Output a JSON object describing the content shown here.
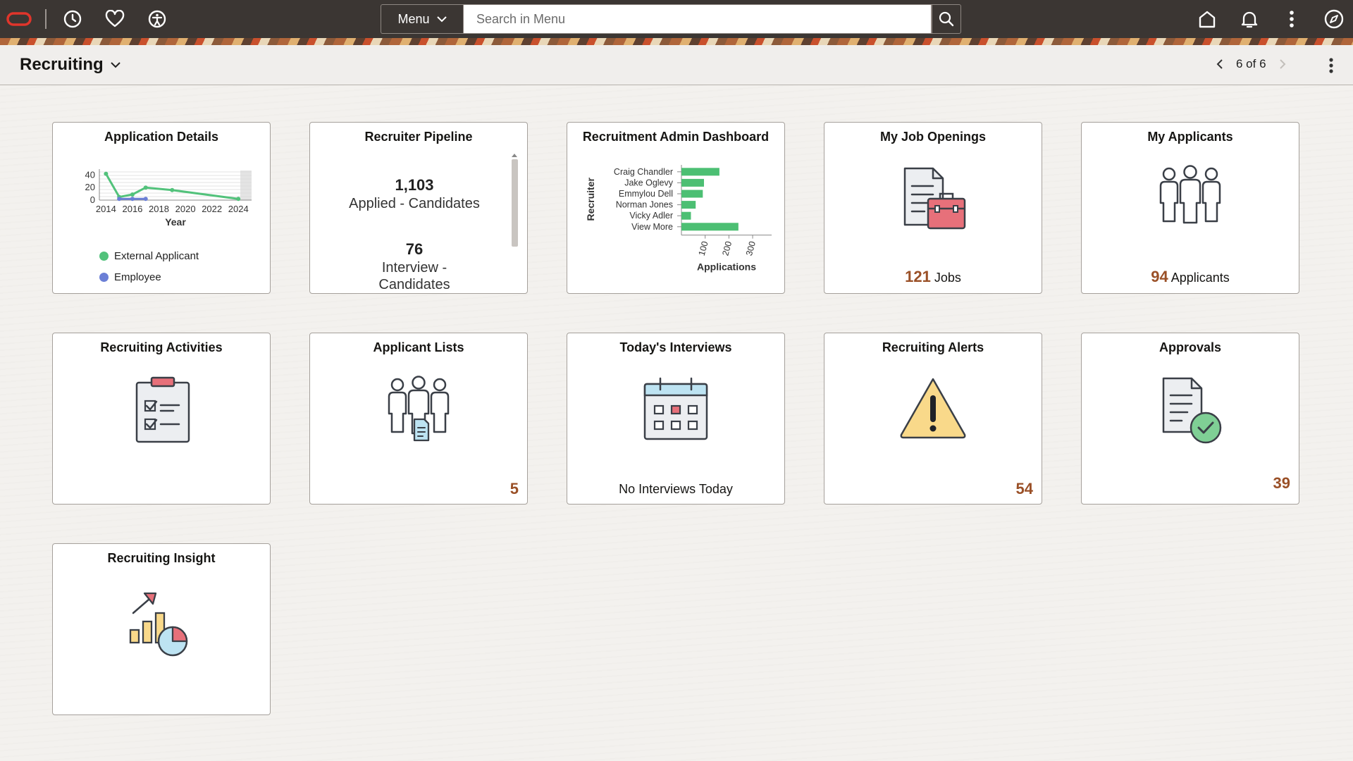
{
  "search": {
    "menu_label": "Menu",
    "placeholder": "Search in Menu"
  },
  "header": {
    "title": "Recruiting",
    "pager": "6 of 6"
  },
  "tiles": {
    "application_details": {
      "title": "Application Details",
      "legend": [
        "External Applicant",
        "Employee"
      ]
    },
    "recruiter_pipeline": {
      "title": "Recruiter Pipeline",
      "applied_count": "1,103",
      "applied_label": "Applied - Candidates",
      "interview_count": "76",
      "interview_label_1": "Interview -",
      "interview_label_2": "Candidates"
    },
    "admin_dashboard": {
      "title": "Recruitment Admin Dashboard"
    },
    "my_job_openings": {
      "title": "My Job Openings",
      "count": "121",
      "unit": "Jobs"
    },
    "my_applicants": {
      "title": "My Applicants",
      "count": "94",
      "unit": "Applicants"
    },
    "recruiting_activities": {
      "title": "Recruiting Activities"
    },
    "applicant_lists": {
      "title": "Applicant Lists",
      "count": "5"
    },
    "todays_interviews": {
      "title": "Today's Interviews",
      "status": "No Interviews Today"
    },
    "recruiting_alerts": {
      "title": "Recruiting Alerts",
      "count": "54"
    },
    "approvals": {
      "title": "Approvals",
      "count": "39"
    },
    "recruiting_insight": {
      "title": "Recruiting Insight"
    }
  },
  "colors": {
    "accent_count": "#9a5027",
    "series_green": "#52c27b",
    "series_blue": "#6b7fd6",
    "bar_green": "#4cbf73"
  },
  "chart_data": [
    {
      "type": "line",
      "x": [
        2014,
        2015,
        2016,
        2017,
        2019,
        2024
      ],
      "series": [
        {
          "name": "External Applicant",
          "x": [
            2014,
            2015,
            2016,
            2017,
            2019,
            2024
          ],
          "values": [
            42,
            5,
            9,
            20,
            16,
            2
          ]
        },
        {
          "name": "Employee",
          "x": [
            2015,
            2016,
            2017
          ],
          "values": [
            2,
            2,
            2
          ]
        }
      ],
      "xlabel": "Year",
      "ylabel": "",
      "xticks": [
        "2014",
        "2016",
        "2018",
        "2020",
        "2022",
        "2024"
      ],
      "yticks": [
        "40",
        "20",
        "0"
      ],
      "xlim": [
        2013.5,
        2025
      ],
      "ylim": [
        0,
        45
      ],
      "legend": "bottom"
    },
    {
      "type": "bar",
      "orientation": "horizontal",
      "categories": [
        "Craig Chandler",
        "Jake Oglevy",
        "Emmylou Dell",
        "Norman Jones",
        "Vicky Adler",
        "View More"
      ],
      "values": [
        160,
        95,
        90,
        60,
        40,
        240
      ],
      "xlabel": "Applications",
      "ylabel": "Recruiter",
      "xticks": [
        "100",
        "200",
        "300"
      ],
      "xlim": [
        0,
        380
      ]
    }
  ]
}
